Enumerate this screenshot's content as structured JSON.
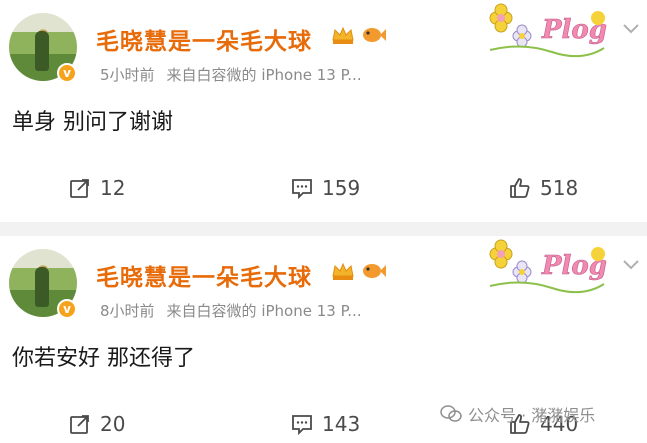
{
  "posts": [
    {
      "username": "毛晓慧是一朵毛大球",
      "time": "5小时前",
      "source": "来自白容微的 iPhone 13 P...",
      "content": "单身 别问了谢谢",
      "reposts": "12",
      "comments": "159",
      "likes": "518",
      "sticker_text": "Plog"
    },
    {
      "username": "毛晓慧是一朵毛大球",
      "time": "8小时前",
      "source": "来自白容微的 iPhone 13 P...",
      "content": "你若安好 那还得了",
      "reposts": "20",
      "comments": "143",
      "likes": "440",
      "sticker_text": "Plog"
    }
  ],
  "watermark": "公众号 · 潴潴娱乐",
  "colors": {
    "username": "#e86b0a",
    "meta": "#8a8a8a",
    "verified": "#f7a21b",
    "separator": "#f2f2f2"
  }
}
